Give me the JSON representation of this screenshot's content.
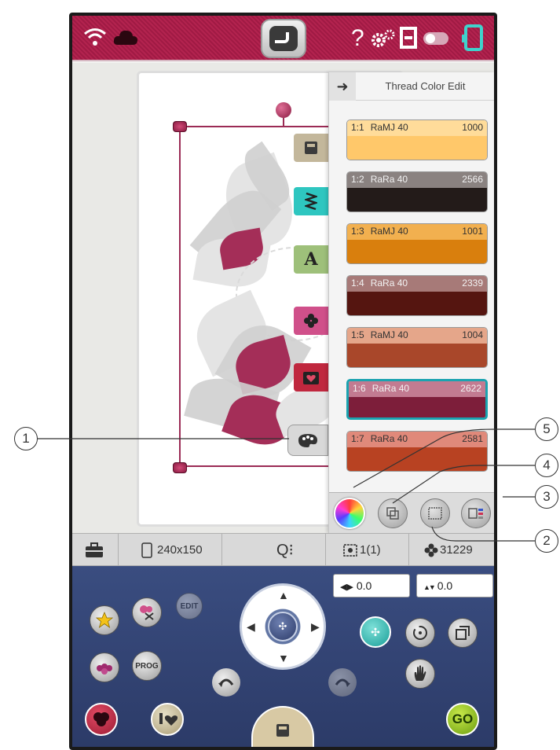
{
  "status_bar": {
    "icons": [
      "wifi-icon",
      "cloud-icon",
      "home-icon",
      "help-icon",
      "settings-icon",
      "memory-icon",
      "toggle-icon",
      "hoop-icon"
    ],
    "help_glyph": "?"
  },
  "canvas": {
    "side_tabs": [
      "image-tab",
      "stitch-tab",
      "text-tab",
      "flower-tab",
      "heart-folder-tab",
      "palette-tab"
    ],
    "text_tab_glyph": "A"
  },
  "thread_panel": {
    "title": "Thread Color Edit",
    "threads": [
      {
        "index": "1:1",
        "name": "RaMJ 40",
        "number": "1000",
        "color": "#ffc86a",
        "label_bg": "#ffdc9a",
        "selected": false
      },
      {
        "index": "1:2",
        "name": "RaRa 40",
        "number": "2566",
        "color": "#231b19",
        "label_bg": "#8a8280",
        "selected": false
      },
      {
        "index": "1:3",
        "name": "RaMJ 40",
        "number": "1001",
        "color": "#d97f0d",
        "label_bg": "#f2b04f",
        "selected": false
      },
      {
        "index": "1:4",
        "name": "RaRa 40",
        "number": "2339",
        "color": "#551510",
        "label_bg": "#a77a78",
        "selected": false
      },
      {
        "index": "1:5",
        "name": "RaMJ 40",
        "number": "1004",
        "color": "#a9472a",
        "label_bg": "#e5a68a",
        "selected": false
      },
      {
        "index": "1:6",
        "name": "RaRa 40",
        "number": "2622",
        "color": "#7d1e3a",
        "label_bg": "#c27b91",
        "selected": true
      },
      {
        "index": "1:7",
        "name": "RaRa 40",
        "number": "2581",
        "color": "#b84222",
        "label_bg": "#e0897a",
        "selected": false
      }
    ],
    "footer_buttons": [
      "color-wheel-icon",
      "group-icon",
      "sort-icon",
      "thread-list-icon"
    ]
  },
  "info_bar": {
    "hoop_size": "240x150",
    "zoom_glyph": "Q⁝",
    "color_count": "1(1)",
    "stitch_count": "31229"
  },
  "controls": {
    "edit_label": "EDIT",
    "prog_label": "PROG",
    "go_label": "GO",
    "x_offset": "0.0",
    "y_offset": "0.0",
    "x_prefix": "◀▶",
    "y_prefix": "▲▼"
  },
  "callouts": [
    "1",
    "2",
    "3",
    "4",
    "5"
  ]
}
